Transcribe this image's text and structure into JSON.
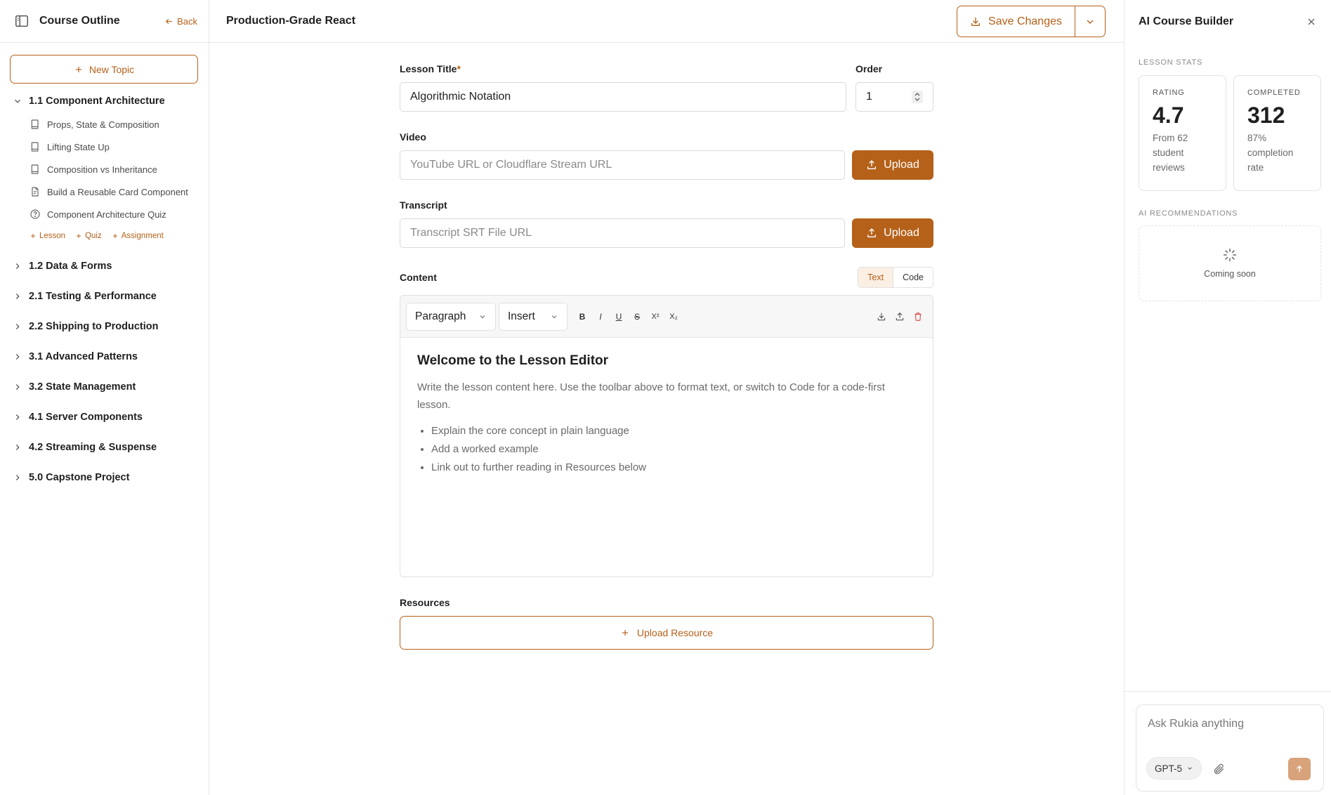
{
  "sidebar": {
    "title": "Course Outline",
    "back_label": "Back",
    "new_topic_label": "New Topic",
    "open_topic": {
      "label": "1.1 Component Architecture",
      "lessons": [
        {
          "label": "Props, State & Composition",
          "icon": "book-icon"
        },
        {
          "label": "Lifting State Up",
          "icon": "book-icon"
        },
        {
          "label": "Composition vs Inheritance",
          "icon": "book-icon"
        },
        {
          "label": "Build a Reusable Card Component",
          "icon": "assignment-icon"
        },
        {
          "label": "Component Architecture Quiz",
          "icon": "quiz-icon"
        }
      ],
      "add_links": {
        "lesson": "Lesson",
        "quiz": "Quiz",
        "assignment": "Assignment"
      }
    },
    "topics": [
      "1.2 Data & Forms",
      "2.1 Testing & Performance",
      "2.2 Shipping to Production",
      "3.1 Advanced Patterns",
      "3.2 State Management",
      "4.1 Server Components",
      "4.2 Streaming & Suspense",
      "5.0 Capstone Project"
    ]
  },
  "header": {
    "page_title": "Production-Grade React",
    "save_label": "Save Changes"
  },
  "form": {
    "lesson_title_label": "Lesson Title",
    "required_mark": "*",
    "lesson_title_value": "Algorithmic Notation",
    "order_label": "Order",
    "order_value": "1",
    "video_label": "Video",
    "video_placeholder": "YouTube URL or Cloudflare Stream URL",
    "transcript_label": "Transcript",
    "transcript_placeholder": "Transcript SRT File URL",
    "upload_label": "Upload",
    "content_label": "Content",
    "mode_text": "Text",
    "mode_code": "Code",
    "block_select": "Paragraph",
    "insert_select": "Insert",
    "toolbar": {
      "bold": "B",
      "italic": "I",
      "underline": "U",
      "strike": "S",
      "superscript": "X²",
      "subscript": "X₂"
    },
    "editor": {
      "heading": "Welcome to the Lesson Editor",
      "paragraph": "Write the lesson content here. Use the toolbar above to format text, or switch to Code for a code-first lesson.",
      "bullets": [
        "Explain the core concept in plain language",
        "Add a worked example",
        "Link out to further reading in Resources below"
      ]
    },
    "resources_label": "Resources",
    "upload_resource_label": "Upload Resource"
  },
  "ai_panel": {
    "title": "AI Course Builder",
    "lesson_stats_label": "LESSON STATS",
    "rating": {
      "label": "RATING",
      "value": "4.7",
      "sub": "From 62 student reviews"
    },
    "completed": {
      "label": "COMPLETED",
      "value": "312",
      "sub": "87% completion rate"
    },
    "recommendations_label": "AI RECOMMENDATIONS",
    "coming_soon": "Coming soon",
    "chat_placeholder": "Ask Rukia anything",
    "model": "GPT-5"
  },
  "colors": {
    "accent": "#b5611a",
    "accent_light": "#fbefe4",
    "send_disabled": "#d8a27a"
  }
}
